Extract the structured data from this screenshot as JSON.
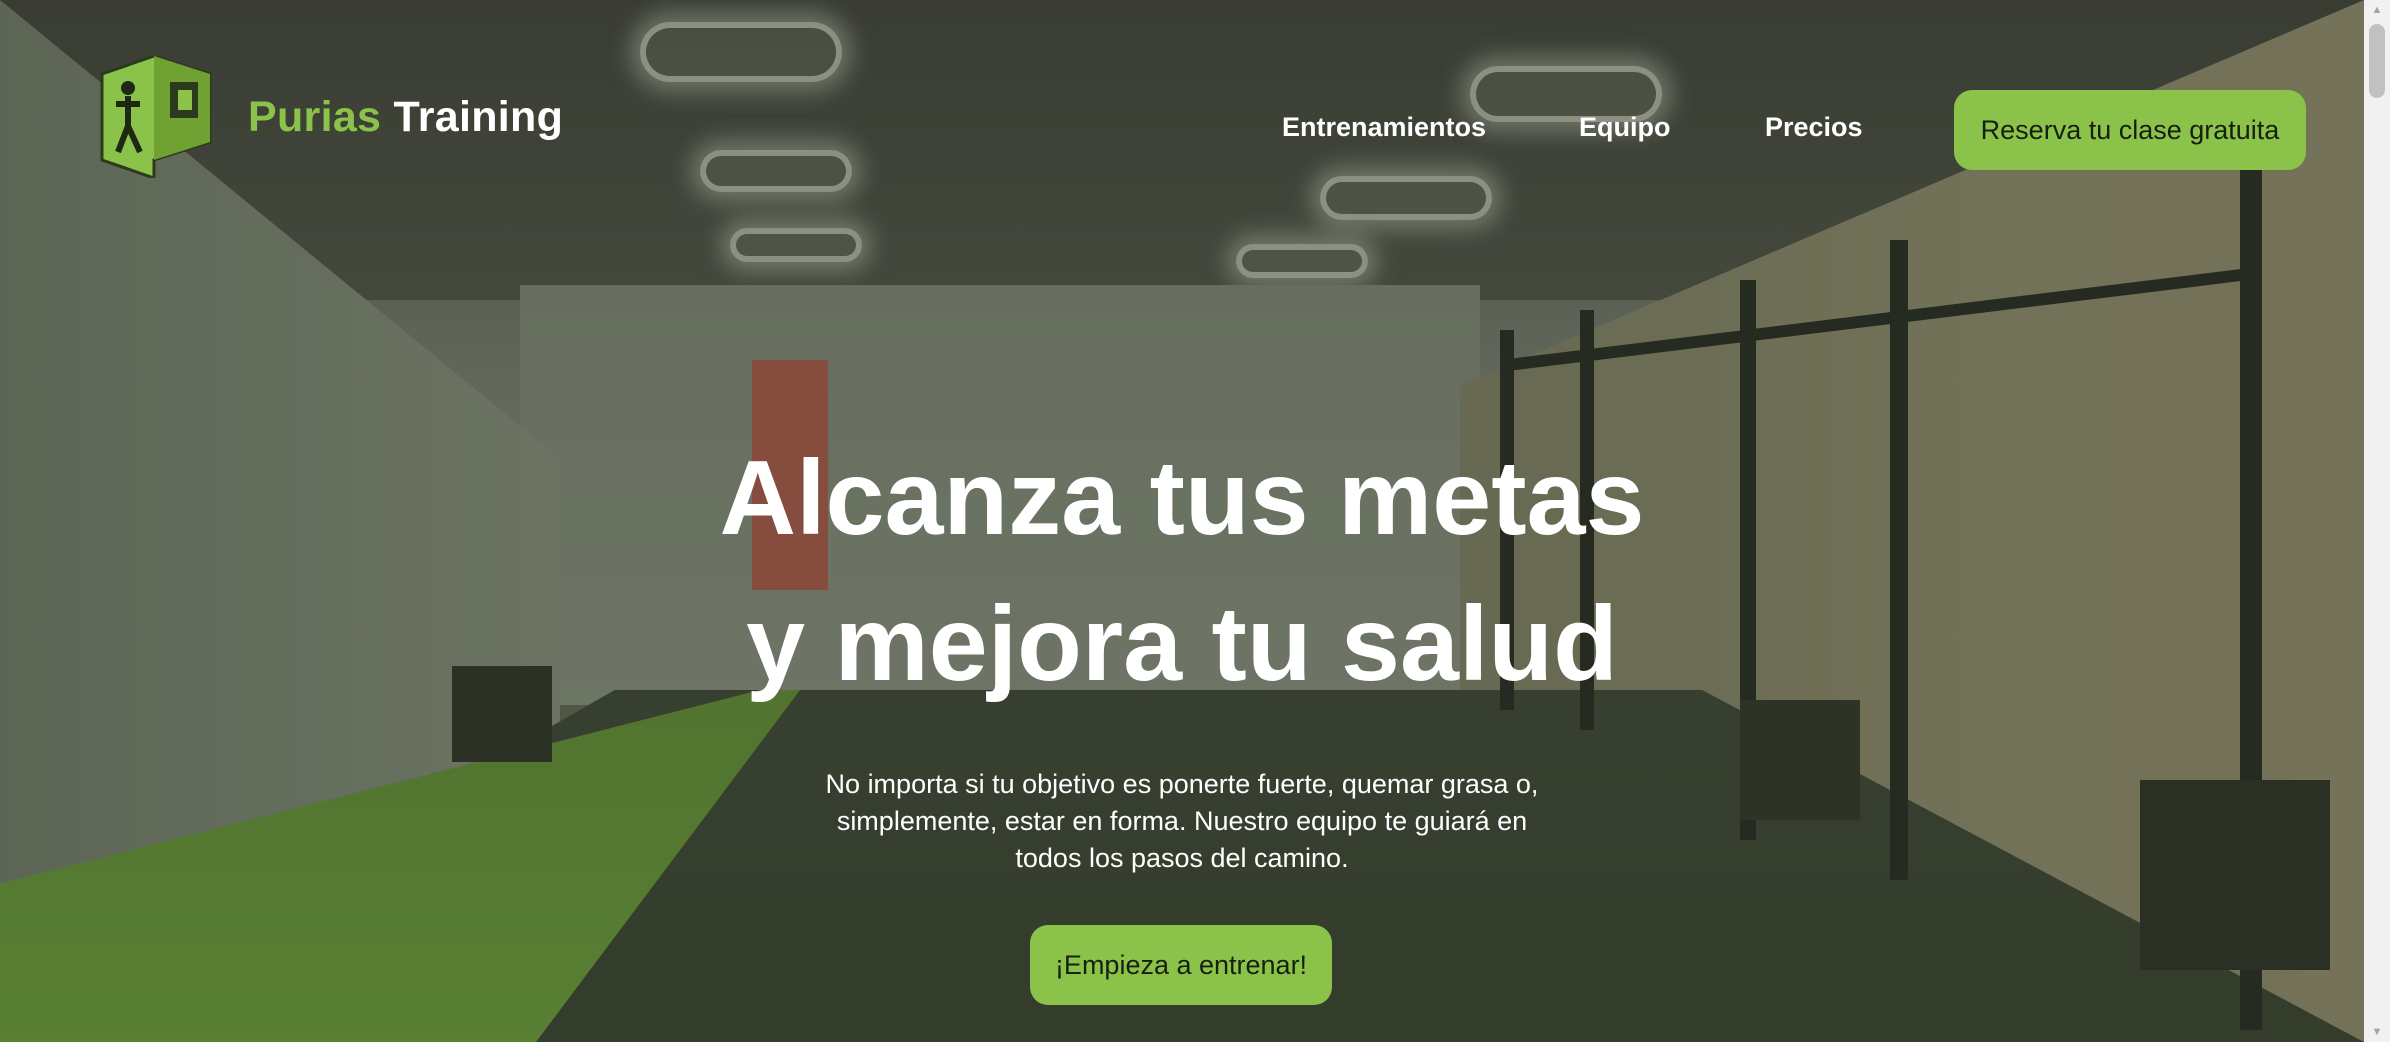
{
  "brand": {
    "name_part1": "Purias",
    "name_part2": "Training"
  },
  "nav": {
    "items": [
      "Entrenamientos",
      "Equipo",
      "Precios"
    ],
    "cta_label": "Reserva tu clase gratuita"
  },
  "hero": {
    "headline_line1": "Alcanza tus metas",
    "headline_line2": "y mejora tu salud",
    "subtitle": "No importa si tu objetivo es ponerte fuerte, quemar grasa o, simplemente, estar en forma. Nuestro equipo te guiará en todos los pasos del camino.",
    "cta_label": "¡Empieza a entrenar!"
  },
  "colors": {
    "accent": "#8bc34a",
    "text_light": "#ffffff",
    "button_text": "#172010"
  },
  "icons": {
    "logo": "purias-p-logo-icon",
    "scroll_up": "chevron-up-icon",
    "scroll_down": "chevron-down-icon"
  }
}
